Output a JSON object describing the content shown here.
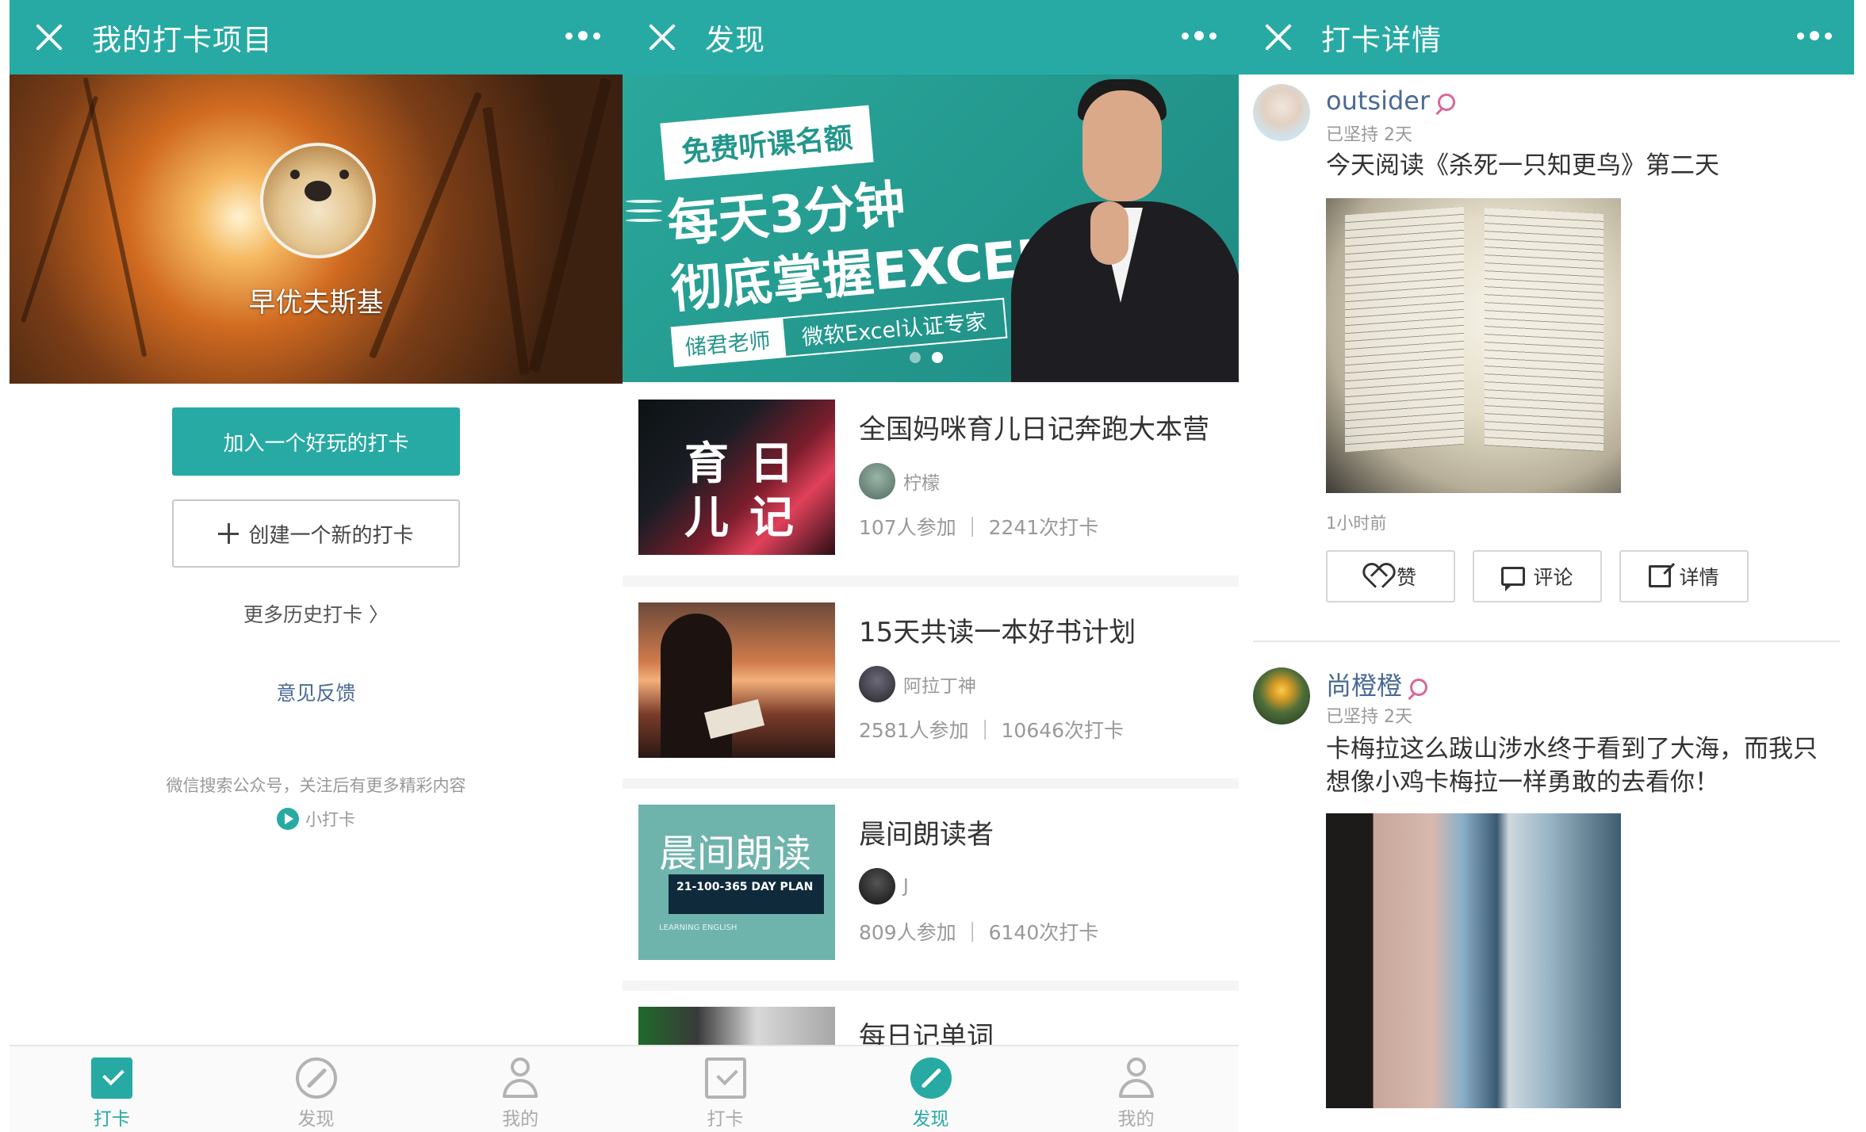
{
  "panel1": {
    "title": "我的打卡项目",
    "username": "早优夫斯基",
    "join_button": "加入一个好玩的打卡",
    "create_button": "创建一个新的打卡",
    "history_link": "更多历史打卡 〉",
    "feedback_link": "意见反馈",
    "hint": "微信搜索公众号，关注后有更多精彩内容",
    "brand": "小打卡"
  },
  "panel2": {
    "title": "发现",
    "banner": {
      "tag": "免费听课名额",
      "line1": "每天3分钟",
      "line2": "彻底掌握EXCEL",
      "teacher": "储君老师",
      "cert": "微软Excel认证专家"
    },
    "cards": [
      {
        "name": "全国妈咪育儿日记奔跑大本营",
        "owner": "柠檬",
        "stats": "107人参加 ｜ 2241次打卡",
        "thumb_words": [
          "育",
          "日",
          "儿",
          "记"
        ]
      },
      {
        "name": "15天共读一本好书计划",
        "owner": "阿拉丁神",
        "stats": "2581人参加 ｜ 10646次打卡"
      },
      {
        "name": "晨间朗读者",
        "owner": "J",
        "stats": "809人参加 ｜ 6140次打卡",
        "thumb_title": "晨间朗读",
        "thumb_plan": "21-100-365 DAY PLAN",
        "thumb_sub": "LEARNING ENGLISH"
      },
      {
        "name": "每日记单词"
      }
    ]
  },
  "panel3": {
    "title": "打卡详情",
    "posts": [
      {
        "author": "outsider",
        "persist": "已坚持 2天",
        "text": "今天阅读《杀死一只知更鸟》第二天",
        "time": "1小时前"
      },
      {
        "author": "尚橙橙",
        "persist": "已坚持 2天",
        "text": "卡梅拉这么跋山涉水终于看到了大海，而我只想像小鸡卡梅拉一样勇敢的去看你！"
      }
    ],
    "actions": {
      "like": "赞",
      "comment": "评论",
      "detail": "详情"
    }
  },
  "tabs": {
    "checkin": "打卡",
    "discover": "发现",
    "mine": "我的"
  },
  "colors": {
    "accent": "#27aaa3",
    "link": "#4a6a95",
    "badge": "#d9679a"
  },
  "icons": [
    "close-icon",
    "more-icon",
    "plus-icon",
    "checkin-icon",
    "compass-icon",
    "person-icon",
    "heart-icon",
    "comment-icon",
    "external-link-icon",
    "badge-icon"
  ]
}
